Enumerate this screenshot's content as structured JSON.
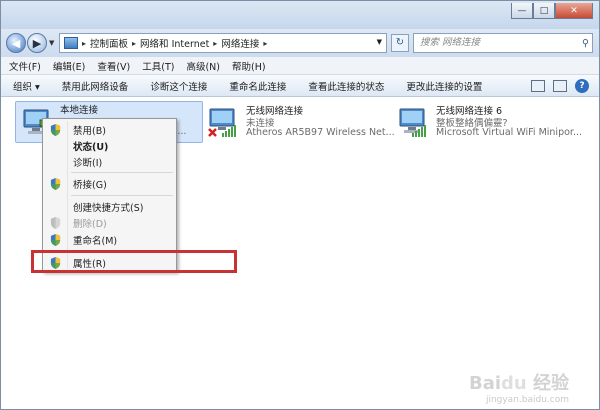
{
  "window": {
    "buttons": {
      "minimize": "—",
      "maximize": "□",
      "close": "✕"
    }
  },
  "address_bar": {
    "crumbs": [
      "控制面板",
      "网络和 Internet",
      "网络连接"
    ],
    "search_placeholder": "搜索 网络连接"
  },
  "menu": [
    "文件(F)",
    "编辑(E)",
    "查看(V)",
    "工具(T)",
    "高级(N)",
    "帮助(H)"
  ],
  "toolbar": {
    "organize": "组织 ▾",
    "items": [
      "禁用此网络设备",
      "诊断这个连接",
      "重命名此连接",
      "查看此连接的状态",
      "更改此连接的设置"
    ]
  },
  "adapters": [
    {
      "name": "本地连接",
      "status": "",
      "device": "…ga..."
    },
    {
      "name": "无线网络连接",
      "status": "未连接",
      "device": "Atheros AR5B97 Wireless Net..."
    },
    {
      "name": "无线网络连接 6",
      "status": "整板整絡偶偏靈?",
      "device": "Microsoft Virtual WiFi Minipor..."
    }
  ],
  "context_menu": [
    {
      "label": "禁用(B)",
      "shield": true,
      "style": "normal"
    },
    {
      "label": "状态(U)",
      "shield": false,
      "style": "bold"
    },
    {
      "label": "诊断(I)",
      "shield": false,
      "style": "normal"
    },
    {
      "label": "桥接(G)",
      "shield": true,
      "style": "normal"
    },
    {
      "label": "创建快捷方式(S)",
      "shield": false,
      "style": "normal"
    },
    {
      "label": "删除(D)",
      "shield": true,
      "style": "disabled"
    },
    {
      "label": "重命名(M)",
      "shield": true,
      "style": "normal"
    },
    {
      "label": "属性(R)",
      "shield": true,
      "style": "normal"
    }
  ],
  "watermark": {
    "logo": "Baidu 经验",
    "url": "jingyan.baidu.com"
  },
  "colors": {
    "highlight_box": "#c83232",
    "selection": "#d5e6fa"
  }
}
